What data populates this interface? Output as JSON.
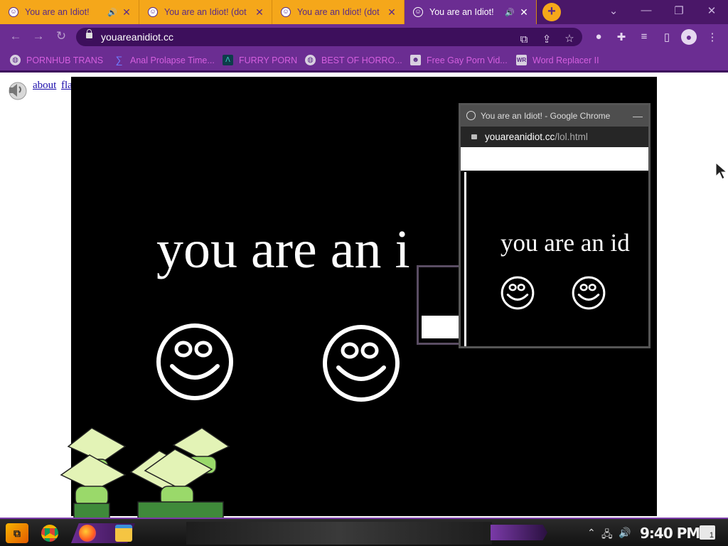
{
  "browser": {
    "tabs": [
      {
        "title": "You are an Idiot!",
        "audio": true,
        "active": false
      },
      {
        "title": "You are an Idiot! (dot",
        "audio": false,
        "active": false
      },
      {
        "title": "You are an Idiot! (dot",
        "audio": false,
        "active": false
      },
      {
        "title": "You are an Idiot!",
        "audio": true,
        "active": true
      }
    ],
    "new_tab_label": "+",
    "url": "youareanidiot.cc",
    "bookmarks": [
      {
        "label": "PORNHUB TRANS",
        "icon": "globe-icon"
      },
      {
        "label": "Anal Prolapse Time...",
        "icon": "sigma-icon"
      },
      {
        "label": "FURRY PORN",
        "icon": "lambda-icon"
      },
      {
        "label": "BEST OF HORRO...",
        "icon": "globe-icon"
      },
      {
        "label": "Free Gay Porn Vid...",
        "icon": "mask-icon"
      },
      {
        "label": "Word Replacer II",
        "icon": "wr-icon"
      }
    ]
  },
  "page": {
    "links": [
      "about",
      "flash"
    ],
    "headline": "you are an i"
  },
  "popup": {
    "window_title": "You are an Idiot! - Google Chrome",
    "url_host": "youareanidiot.cc",
    "url_path": "/lol.html",
    "headline": "you are an id"
  },
  "taskbar": {
    "clock": "9:40 PM",
    "notification_count": "1"
  },
  "colors": {
    "tab_inactive": "#f5a71a",
    "tab_active": "#6b2d92",
    "frame": "#4a1768",
    "bookmark_text": "#d45fdf"
  }
}
